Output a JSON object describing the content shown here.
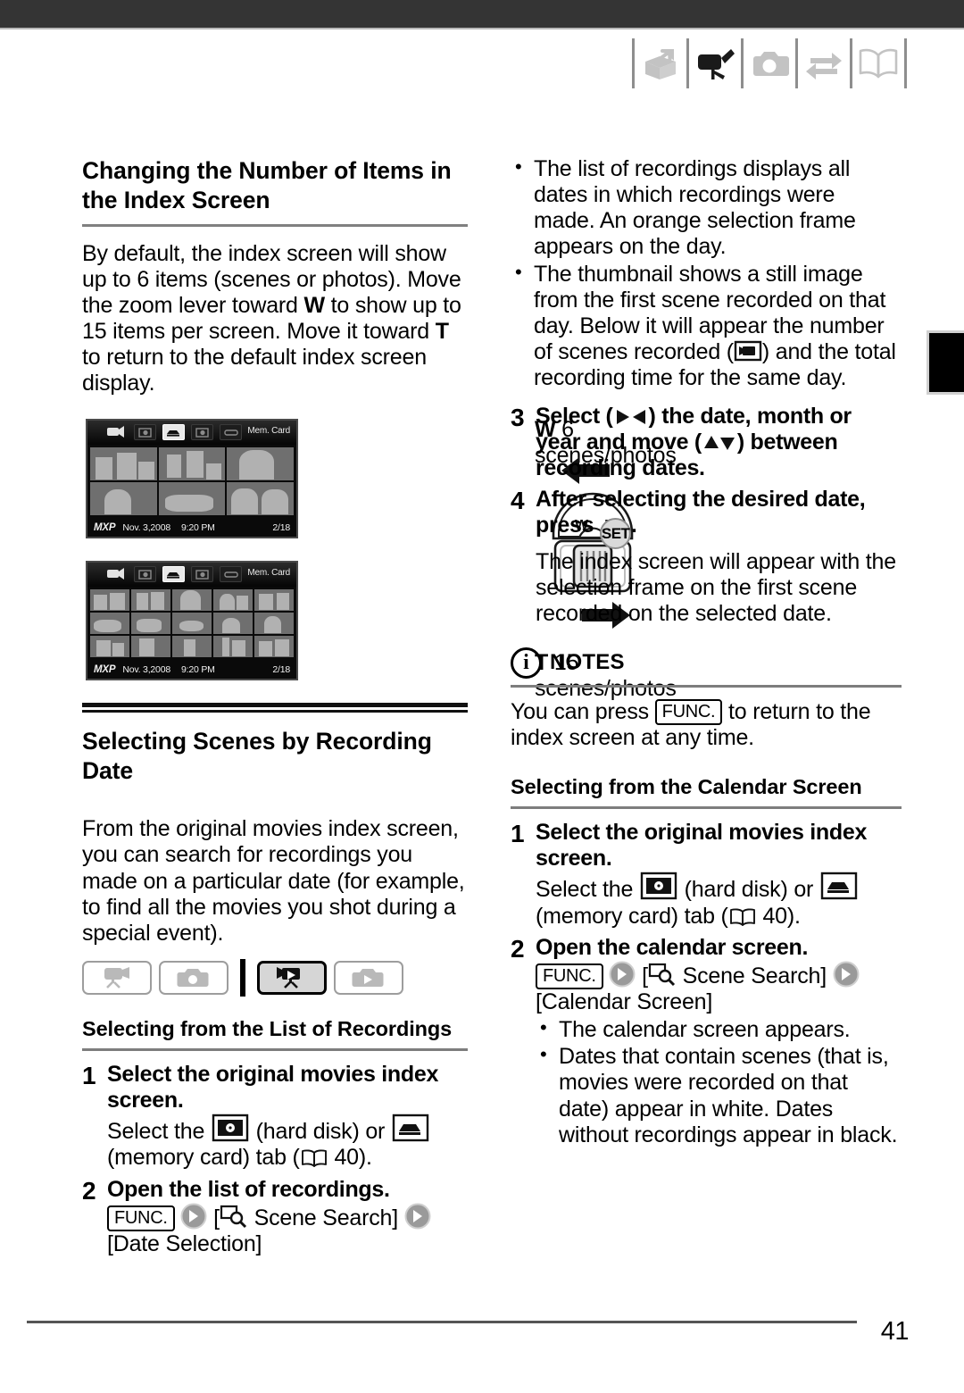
{
  "header": {
    "icons": [
      {
        "name": "unpack-box-icon",
        "state": "inactive"
      },
      {
        "name": "camcorder-icon",
        "state": "active"
      },
      {
        "name": "photo-camera-icon",
        "state": "inactive"
      },
      {
        "name": "transfer-arrows-icon",
        "state": "inactive"
      },
      {
        "name": "open-book-icon",
        "state": "inactive"
      }
    ]
  },
  "left_column": {
    "section_title": "Changing the Number of Items in the Index Screen",
    "intro_paragraph_parts": {
      "p1": "By default, the index screen will show up to 6 items (scenes or photos). Move the zoom lever toward ",
      "w1": "W",
      "p2": " to show up to 15 items per screen. Move it toward ",
      "t1": "T",
      "p3": " to return to the default index screen display."
    },
    "figure": {
      "screen_top": {
        "badge": "Mem. Card",
        "mxp": "MXP",
        "date": "Nov. 3,2008",
        "time": "9:20 PM",
        "counter": "2/18",
        "items": 6
      },
      "screen_bottom": {
        "badge": "Mem. Card",
        "mxp": "MXP",
        "date": "Nov. 3,2008",
        "time": "9:20 PM",
        "counter": "2/18",
        "items": 15
      },
      "caption_top_key": "W",
      "caption_top_text": " 6 scenes/photos",
      "caption_bottom_key": "T",
      "caption_bottom_text": " 15 scenes/photos",
      "lever_w": "W",
      "lever_t": "T"
    },
    "section2_title": "Selecting Scenes by Recording Date",
    "section2_paragraph": "From the original movies index screen, you can search for recordings you made on a particular date (for example, to find all the movies you shot during a special event).",
    "mode_buttons": [
      {
        "name": "movie-record-mode-icon",
        "state": "inactive"
      },
      {
        "name": "photo-record-mode-icon",
        "state": "inactive"
      },
      {
        "name": "movie-playback-mode-icon",
        "state": "active"
      },
      {
        "name": "photo-playback-mode-icon",
        "state": "inactive"
      }
    ],
    "sub_title": "Selecting from the List of Recordings",
    "steps": [
      {
        "num": "1",
        "head": "Select the original movies index screen.",
        "sub_a": "Select the ",
        "sub_b": " (hard disk) or ",
        "sub_c": " (memory card) tab (",
        "sub_page": "40",
        "sub_d": ")."
      },
      {
        "num": "2",
        "head": "Open the list of recordings.",
        "func": "FUNC.",
        "menu1": "Scene Search",
        "menu2": "[Date Selection]"
      }
    ]
  },
  "right_column": {
    "bullets_top": [
      "The list of recordings displays all dates in which recordings were made. An orange selection frame appears on the day.",
      "The thumbnail shows a still image from the first scene recorded on that day. Below it will appear the number of scenes recorded ( ) and the total recording time for the same day."
    ],
    "bullet2_parts": {
      "a": "The thumbnail shows a still image from the first scene recorded on that day. Below it will appear the number of scenes recorded (",
      "b": ") and the total recording time for the same day."
    },
    "steps": [
      {
        "num": "3",
        "head_a": "Select (",
        "head_b": ") the date, month or year and move (",
        "head_c": ") between recording dates."
      },
      {
        "num": "4",
        "head_a": "After selecting the desired date, press ",
        "set": "SET",
        "head_b": ".",
        "sub": "The index screen will appear with the selection frame on the first scene recorded on the selected date."
      }
    ],
    "notes": {
      "label": "NOTES",
      "text_a": "You can press ",
      "func": "FUNC.",
      "text_b": " to return to the index screen at any time."
    },
    "sub_title": "Selecting from the Calendar Screen",
    "steps2": [
      {
        "num": "1",
        "head": "Select the original movies index screen.",
        "sub_a": "Select the ",
        "sub_b": " (hard disk) or ",
        "sub_c": " (memory card) tab (",
        "sub_page": "40",
        "sub_d": ")."
      },
      {
        "num": "2",
        "head": "Open the calendar screen.",
        "func": "FUNC.",
        "menu1": "Scene Search",
        "menu2": "[Calendar Screen]",
        "bullets": [
          "The calendar screen appears.",
          "Dates that contain scenes (that is, movies were recorded on that date) appear in white. Dates without recordings appear in black."
        ]
      }
    ]
  },
  "footer": {
    "page_number": "41"
  },
  "colors": {
    "topbar": "#343434",
    "rule": "#7d7d7d",
    "icon_gray": "#c0c0c0",
    "icon_black": "#1a1a1a"
  }
}
